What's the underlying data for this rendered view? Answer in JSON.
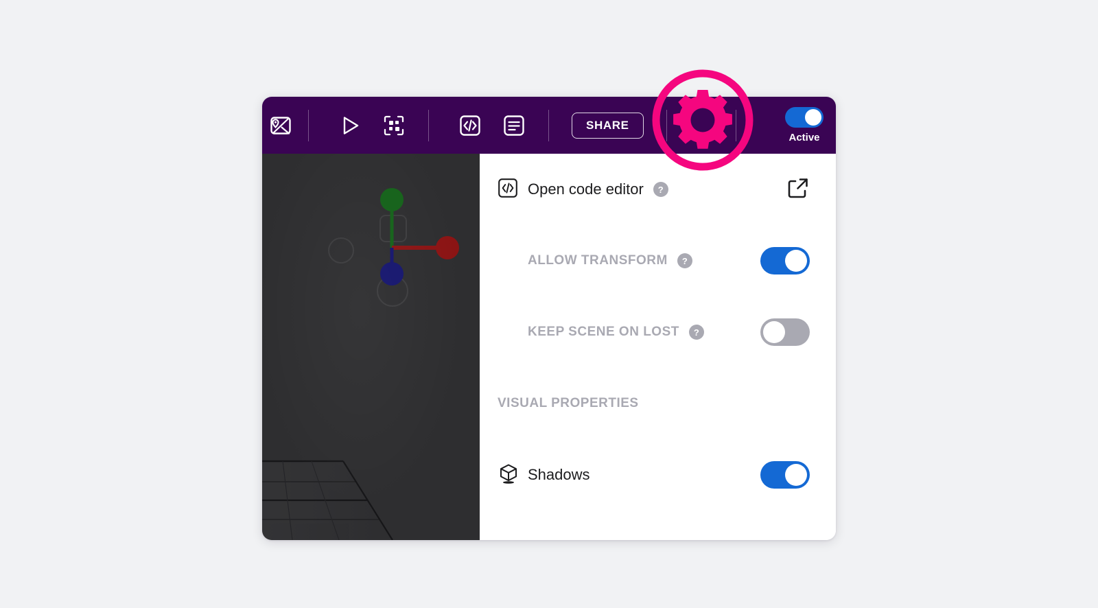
{
  "colors": {
    "toolbar_bg": "#3a0454",
    "panel_bg": "#ffffff",
    "viewport_bg": "#2e2e30",
    "page_bg": "#f1f2f4",
    "switch_on": "#1469d4",
    "switch_off": "#a9a9b2",
    "muted_text": "#a9a9b2",
    "highlight_pink": "#f5067f",
    "axis_x": "#8b1414",
    "axis_y": "#15621a",
    "axis_z": "#16166e"
  },
  "toolbar": {
    "buttons": [
      {
        "name": "map-preview-icon",
        "label": "Map preview"
      },
      {
        "name": "play-icon",
        "label": "Play"
      },
      {
        "name": "qr-code-icon",
        "label": "QR code"
      },
      {
        "name": "code-icon",
        "label": "Code"
      },
      {
        "name": "document-icon",
        "label": "Document"
      }
    ],
    "share_label": "SHARE",
    "settings_label": "Settings",
    "active_label": "Active",
    "active_on": true
  },
  "panel": {
    "rows": [
      {
        "id": "open-code-editor",
        "label": "Open code editor",
        "style": "normal",
        "icon": "code-icon",
        "has_help": true,
        "help_glyph": "?",
        "control": "external-link"
      },
      {
        "id": "allow-transform",
        "label": "ALLOW TRANSFORM",
        "style": "caps",
        "icon": null,
        "has_help": true,
        "help_glyph": "?",
        "control": "switch",
        "switch_on": true
      },
      {
        "id": "keep-scene-on-lost",
        "label": "KEEP SCENE ON LOST",
        "style": "caps",
        "icon": null,
        "has_help": true,
        "help_glyph": "?",
        "control": "switch",
        "switch_on": false
      },
      {
        "id": "visual-properties",
        "label": "VISUAL PROPERTIES",
        "style": "section",
        "icon": null,
        "has_help": false,
        "control": "none"
      },
      {
        "id": "shadows",
        "label": "Shadows",
        "style": "normal",
        "icon": "cube-shadow-icon",
        "has_help": false,
        "control": "switch",
        "switch_on": true
      }
    ]
  },
  "viewport": {
    "gizmo": {
      "x_axis_color": "#8b1414",
      "y_axis_color": "#15621a",
      "z_axis_color": "#16166e"
    }
  },
  "annotation": {
    "type": "highlight-ring",
    "target": "settings-button",
    "icon": "gear-icon",
    "color": "#f5067f"
  }
}
